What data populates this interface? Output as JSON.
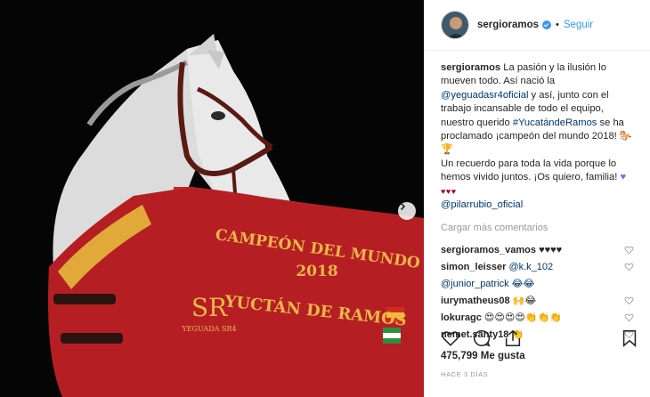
{
  "photo": {
    "blanket_line1": "CAMPEÓN DEL MUNDO",
    "blanket_year": "2018",
    "blanket_line2": "YUCTÁN DE RAMOS",
    "logo_letters": "SR",
    "logo_text": "YEGUADA SR4",
    "colors": {
      "blanket": "#b51f24",
      "gold": "#e0a93a",
      "horse": "#e2e2e2",
      "bg": "#050505"
    }
  },
  "header": {
    "username": "sergioramos",
    "separator": "•",
    "follow_label": "Seguir"
  },
  "caption": {
    "username": "sergioramos",
    "text_1": "La pasión y la ilusión lo mueven todo. Así nació la",
    "mention_1": "@yeguadasr4oficial",
    "text_2": "y así, junto con el trabajo incansable de todo el equipo, nuestro querido",
    "hashtag": "#YucatándeRamos",
    "text_3": "se ha proclamado ¡campeón del mundo 2018!",
    "text_4": "Un recuerdo para toda la vida porque lo hemos vivido juntos. ¡Os quiero, familia!",
    "hearts": "♥♥♥",
    "mention_2": "@pilarrubio_oficial"
  },
  "load_more_label": "Cargar más comentarios",
  "comments": [
    {
      "user": "sergioramos_vamos",
      "text": "♥♥♥♥"
    },
    {
      "user": "simon_leisser",
      "text": "@k.k_102"
    },
    {
      "user": "",
      "text": "@junior_patrick 😂😂"
    },
    {
      "user": "iurymatheus08",
      "text": "🙌😂"
    },
    {
      "user": "lokuragc",
      "text": "😍😍😍😍👏👏👏"
    },
    {
      "user": "nemet.santy18",
      "text": "👏"
    }
  ],
  "likes": {
    "count": "475,799",
    "label": "Me gusta"
  },
  "timestamp": "HACE 3 DÍAS"
}
